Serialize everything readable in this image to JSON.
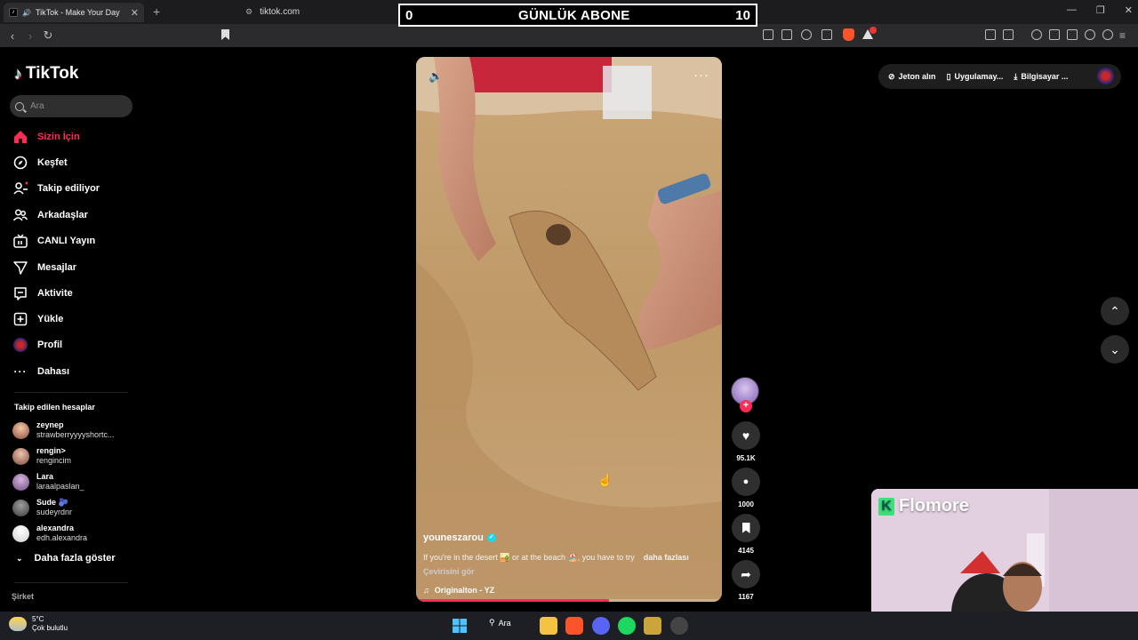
{
  "browser": {
    "tab_title": "TikTok - Make Your Day",
    "url": "tiktok.com"
  },
  "scoreboard": {
    "left": "0",
    "title": "GÜNLÜK ABONE",
    "right": "10"
  },
  "sidebar": {
    "brand": "TikTok",
    "search_placeholder": "Ara",
    "nav": [
      {
        "label": "Sizin İçin",
        "icon": "home-icon",
        "active": true
      },
      {
        "label": "Keşfet",
        "icon": "compass-icon"
      },
      {
        "label": "Takip ediliyor",
        "icon": "following-icon"
      },
      {
        "label": "Arkadaşlar",
        "icon": "friends-icon"
      },
      {
        "label": "CANLI Yayın",
        "icon": "live-tv-icon"
      },
      {
        "label": "Mesajlar",
        "icon": "paper-plane-icon"
      },
      {
        "label": "Aktivite",
        "icon": "activity-icon"
      },
      {
        "label": "Yükle",
        "icon": "upload-plus-icon"
      },
      {
        "label": "Profil",
        "icon": "profile-avatar-icon"
      },
      {
        "label": "Dahası",
        "icon": "more-dots-icon"
      }
    ],
    "followed_title": "Takip edilen hesaplar",
    "accounts": [
      {
        "name": "zeynep",
        "handle": "strawberryyyyshortc..."
      },
      {
        "name": "rengin>",
        "handle": "rengincim"
      },
      {
        "name": "Lara",
        "handle": "laraalpaslan_"
      },
      {
        "name": "Sude 🫐",
        "handle": "sudeyrdnr"
      },
      {
        "name": "alexandra",
        "handle": "edh.alexandra"
      }
    ],
    "show_more": "Daha fazla göster",
    "company": "Şirket"
  },
  "video": {
    "author": "youneszarou",
    "description": "If you're in the desert 🏜️ or at the beach 🏖️, you have to try",
    "more": "daha fazlası",
    "translate": "Çevirisini gör",
    "music": "Originalton - YZ",
    "progress": 0.63
  },
  "actions": {
    "likes": "95.1K",
    "comments": "1000",
    "saves": "4145",
    "shares": "1167"
  },
  "topbar": {
    "coins": "Jeton alın",
    "app": "Uygulamay...",
    "desktop": "Bilgisayar ..."
  },
  "webcam": {
    "brand": "Flomore"
  },
  "taskbar": {
    "temp": "5°C",
    "weather": "Çok bulutlu",
    "search": "Ara"
  }
}
